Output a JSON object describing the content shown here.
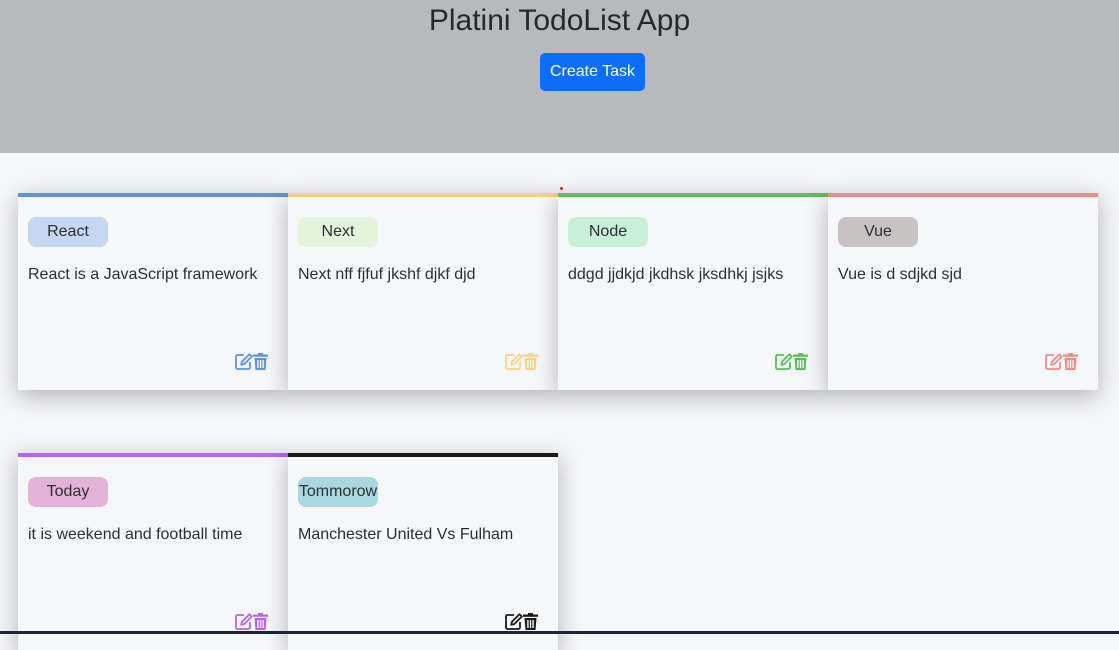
{
  "header": {
    "title": "Platini TodoList App",
    "create_label": "Create Task"
  },
  "cards": [
    {
      "badge": "React",
      "desc": "React is a JavaScript framework",
      "primary": "#5d93e1",
      "secondary": "#c5d8f1"
    },
    {
      "badge": "Next",
      "desc": "Next nff fjfuf jkshf djkf djd",
      "primary": "#f9d288",
      "secondary": "#e4f3dc"
    },
    {
      "badge": "Node",
      "desc": "ddgd jjdkjd jkdhsk jksdhkj jsjks",
      "primary": "#5cbf58",
      "secondary": "#c8f0d8"
    },
    {
      "badge": "Vue",
      "desc": "Vue is d sdjkd sjd",
      "primary": "#f28a8a",
      "secondary": "#c9c2c2"
    },
    {
      "badge": "Today",
      "desc": "it is weekend and football time",
      "primary": "#b964f0",
      "secondary": "#e2b3d7"
    },
    {
      "badge": "Tommorow",
      "desc": "Manchester United Vs Fulham",
      "primary": "#1a1a1a",
      "secondary": "#a9d8e0"
    }
  ],
  "icons": {
    "edit": "edit-icon",
    "delete": "trash-icon"
  }
}
